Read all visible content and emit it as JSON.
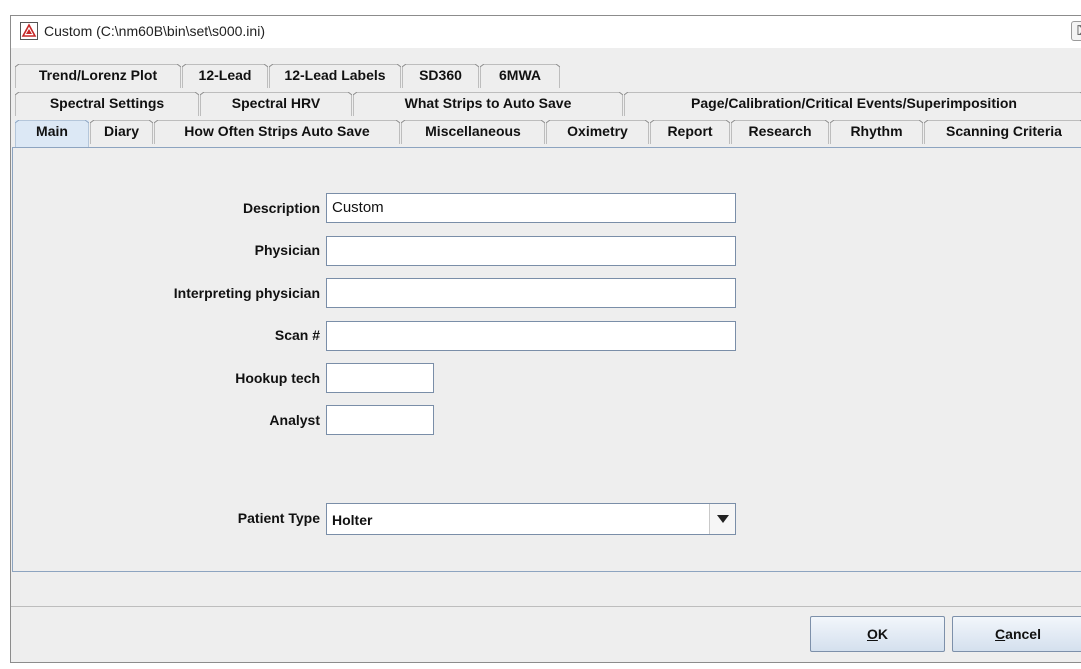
{
  "window": {
    "title": "Custom (C:\\nm60B\\bin\\set\\s000.ini)",
    "close_glyph": "⌧"
  },
  "tabs": {
    "row1": [
      "Trend/Lorenz Plot",
      "12-Lead",
      "12-Lead Labels",
      "SD360",
      "6MWA"
    ],
    "row2": [
      "Spectral Settings",
      "Spectral HRV",
      "What Strips to Auto Save",
      "Page/Calibration/Critical Events/Superimposition"
    ],
    "row3": [
      "Main",
      "Diary",
      "How Often Strips Auto Save",
      "Miscellaneous",
      "Oximetry",
      "Report",
      "Research",
      "Rhythm",
      "Scanning Criteria"
    ],
    "selected": "Main"
  },
  "form": {
    "description": {
      "label": "Description",
      "value": "Custom"
    },
    "physician": {
      "label": "Physician",
      "value": ""
    },
    "interpreting_physician": {
      "label": "Interpreting physician",
      "value": ""
    },
    "scan_number": {
      "label": "Scan #",
      "value": ""
    },
    "hookup_tech": {
      "label": "Hookup tech",
      "value": ""
    },
    "analyst": {
      "label": "Analyst",
      "value": ""
    },
    "patient_type": {
      "label": "Patient Type",
      "value": "Holter"
    }
  },
  "buttons": {
    "ok": {
      "mnemonic": "O",
      "rest": "K"
    },
    "cancel": {
      "mnemonic": "C",
      "rest": "ancel"
    }
  },
  "colors": {
    "selected_tab": "#dce8f5",
    "panel_border": "#8da4c0",
    "window_bg": "#eeeeee"
  },
  "icons": {
    "app": "app-logo-icon",
    "close": "close-icon",
    "dropdown": "chevron-down-icon"
  }
}
